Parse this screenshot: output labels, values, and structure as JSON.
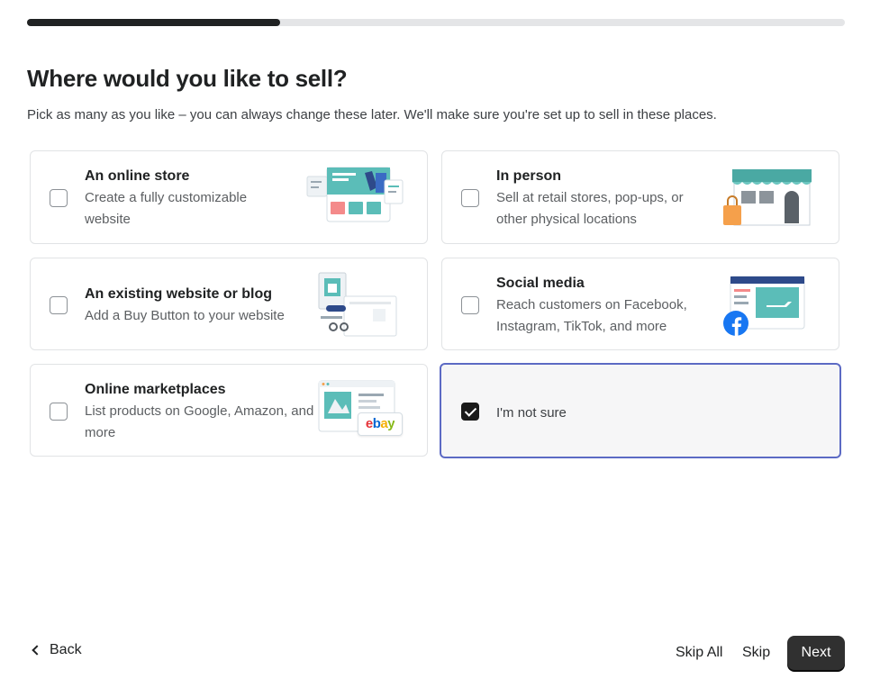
{
  "progress": {
    "fraction": 0.31
  },
  "header": {
    "title": "Where would you like to sell?",
    "subtitle": "Pick as many as you like – you can always change these later. We'll make sure you're set up to sell in these places."
  },
  "options": [
    {
      "title": "An online store",
      "description": "Create a fully customizable website",
      "checked": false,
      "icon": "online-store-illustration"
    },
    {
      "title": "In person",
      "description": "Sell at retail stores, pop-ups, or other physical locations",
      "checked": false,
      "icon": "storefront-illustration"
    },
    {
      "title": "An existing website or blog",
      "description": "Add a Buy Button to your website",
      "checked": false,
      "icon": "buy-button-illustration"
    },
    {
      "title": "Social media",
      "description": "Reach customers on Facebook, Instagram, TikTok, and more",
      "checked": false,
      "icon": "social-media-illustration"
    },
    {
      "title": "Online marketplaces",
      "description": "List products on Google, Amazon, and more",
      "checked": false,
      "icon": "marketplace-illustration",
      "badge": "ebay"
    },
    {
      "title": "I'm not sure",
      "description": "",
      "checked": true
    }
  ],
  "footer": {
    "back_label": "Back",
    "skip_all_label": "Skip All",
    "skip_label": "Skip",
    "next_label": "Next"
  },
  "colors": {
    "primary_button": "#303030",
    "selected_border": "#5c6ac4",
    "progress_fill": "#202223",
    "illustration_teal": "#5bbdb8",
    "illustration_orange": "#f5a04b",
    "facebook_blue": "#1877f2"
  }
}
